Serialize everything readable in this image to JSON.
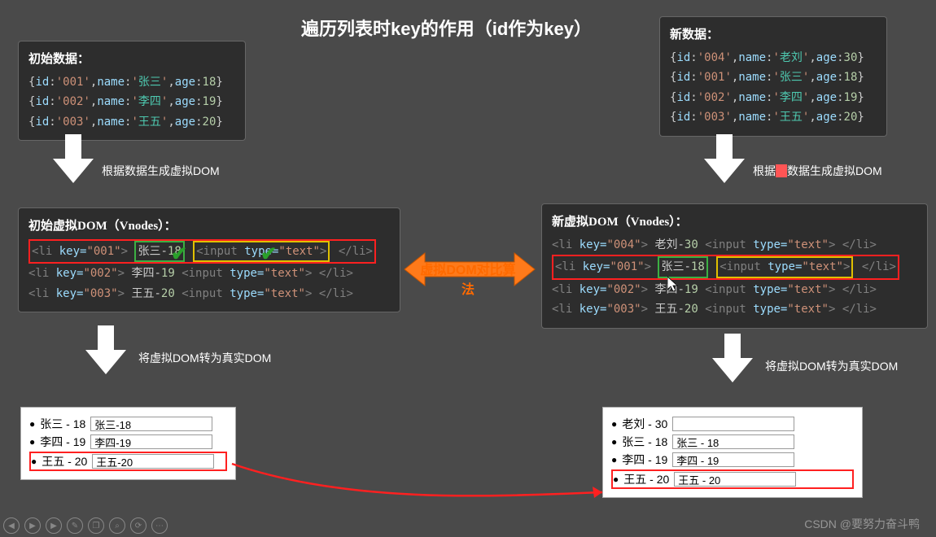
{
  "title": "遍历列表时key的作用（id作为key）",
  "left": {
    "dataTitle": "初始数据：",
    "rows": [
      "{id:'001',name:'张三',age:18}",
      "{id:'002',name:'李四',age:19}",
      "{id:'003',name:'王五',age:20}"
    ],
    "arrow1": "根据数据生成虚拟DOM",
    "vnodeTitle": "初始虚拟DOM（Vnodes）：",
    "vnodes": [
      {
        "key": "001",
        "txt": "张三-18",
        "hl": "red"
      },
      {
        "key": "002",
        "txt": "李四-19",
        "hl": ""
      },
      {
        "key": "003",
        "txt": "王五-20",
        "hl": ""
      }
    ],
    "arrow2": "将虚拟DOM转为真实DOM",
    "dom": [
      {
        "label": "张三 - 18",
        "val": "张三-18",
        "boxed": false
      },
      {
        "label": "李四 - 19",
        "val": "李四-19",
        "boxed": false
      },
      {
        "label": "王五 - 20",
        "val": "王五-20",
        "boxed": true
      }
    ]
  },
  "right": {
    "dataTitle": "新数据：",
    "rows": [
      "{id:'004',name:'老刘',age:30}",
      "{id:'001',name:'张三',age:18}",
      "{id:'002',name:'李四',age:19}",
      "{id:'003',name:'王五',age:20}"
    ],
    "arrow1pre": "根据",
    "arrow1hl": "新",
    "arrow1post": "数据生成虚拟DOM",
    "vnodeTitle": "新虚拟DOM（Vnodes）：",
    "vnodes": [
      {
        "key": "004",
        "txt": "老刘-30",
        "hl": ""
      },
      {
        "key": "001",
        "txt": "张三-18",
        "hl": "red"
      },
      {
        "key": "002",
        "txt": "李四-19",
        "hl": ""
      },
      {
        "key": "003",
        "txt": "王五-20",
        "hl": ""
      }
    ],
    "arrow2": "将虚拟DOM转为真实DOM",
    "dom": [
      {
        "label": "老刘 - 30",
        "val": "",
        "boxed": false
      },
      {
        "label": "张三 - 18",
        "val": "张三 - 18",
        "boxed": false
      },
      {
        "label": "李四 - 19",
        "val": "李四 - 19",
        "boxed": false
      },
      {
        "label": "王五 - 20",
        "val": "王五 - 20",
        "boxed": true
      }
    ]
  },
  "middleLabel": "虚拟DOM对比算法",
  "watermark": "CSDN @要努力奋斗鸭",
  "toolbarIcons": [
    "prev",
    "play",
    "next",
    "pen",
    "copy",
    "zoom",
    "refresh",
    "more"
  ]
}
